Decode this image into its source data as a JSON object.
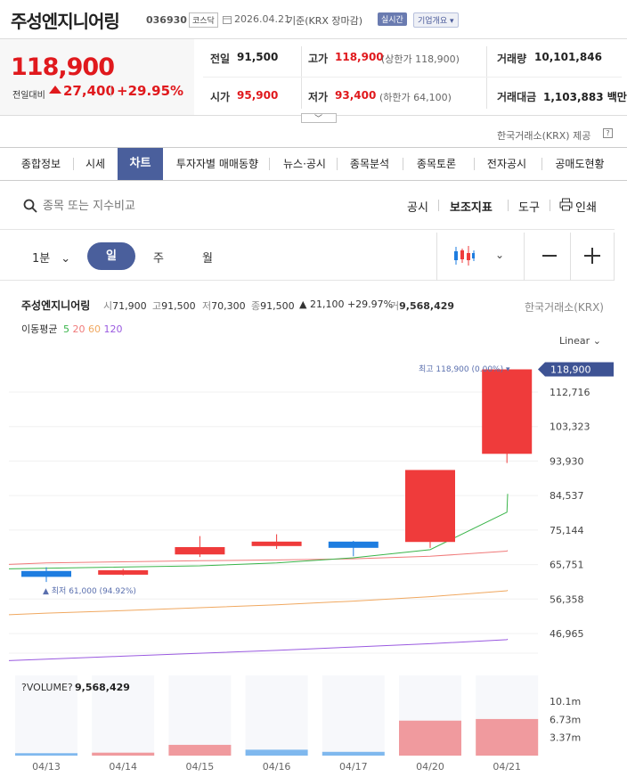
{
  "header": {
    "name": "주성엔지니어링",
    "code": "036930",
    "market_badge": "코스닥",
    "date": "2026.04.21",
    "basis": "기준(KRX 장마감)",
    "live_badge": "실시간",
    "company_badge": "기업개요"
  },
  "price": {
    "current": "118,900",
    "change_label": "전일대비",
    "change": "27,400",
    "change_pct": "+29.95%"
  },
  "stats": {
    "prev_label": "전일",
    "prev": "91,500",
    "high_label": "고가",
    "high": "118,900",
    "high_sub": "(상한가 118,900)",
    "volume_label": "거래량",
    "volume": "10,101,846",
    "open_label": "시가",
    "open": "95,900",
    "low_label": "저가",
    "low": "93,400",
    "low_sub": "(하한가 64,100)",
    "amount_label": "거래대금",
    "amount": "1,103,883 백만"
  },
  "provider": "한국거래소(KRX) 제공",
  "tabs": [
    {
      "label": "종합정보"
    },
    {
      "label": "시세"
    },
    {
      "label": "차트"
    },
    {
      "label": "투자자별 매매동향"
    },
    {
      "label": "뉴스·공시"
    },
    {
      "label": "종목분석"
    },
    {
      "label": "종목토론"
    },
    {
      "label": "전자공시"
    },
    {
      "label": "공매도현황"
    }
  ],
  "toolbar": {
    "search_placeholder": "종목 또는 지수비교",
    "disclosure": "공시",
    "indicator": "보조지표",
    "tools": "도구",
    "print": "인쇄"
  },
  "periods": {
    "minute": "1분",
    "day": "일",
    "week": "주",
    "month": "월"
  },
  "info": {
    "name": "주성엔지니어링",
    "open_k": "시",
    "open": "71,900",
    "high_k": "고",
    "high": "91,500",
    "low_k": "저",
    "low": "70,300",
    "close_k": "종",
    "close": "91,500",
    "change": "▲ 21,100 +29.97%",
    "vol_k": "거",
    "vol": "9,568,429",
    "exchange": "한국거래소(KRX)",
    "ma_label": "이동평균",
    "ma5": "5",
    "ma20": "20",
    "ma60": "60",
    "ma120": "120",
    "scale": "Linear"
  },
  "colors": {
    "up": "#ef3b3b",
    "down": "#1e7de0",
    "ma5": "#3ab54a",
    "ma20": "#f07a7a",
    "ma60": "#f0a860",
    "ma120": "#9a5ae0",
    "accent": "#4a5f9c"
  },
  "chart_data": {
    "type": "candlestick",
    "y_axis_ticks": [
      "112,716",
      "103,323",
      "93,930",
      "84,537",
      "75,144",
      "65,751",
      "56,358",
      "46,965"
    ],
    "last_price_tag": "118,900",
    "max_label": "최고 118,900 (0.00%)",
    "min_label": "최저 61,000 (94.92%)",
    "candles": [
      {
        "date": "04/13",
        "open": 64000,
        "high": 65000,
        "low": 61000,
        "close": 62400
      },
      {
        "date": "04/14",
        "open": 63400,
        "high": 64600,
        "low": 62800,
        "close": 64200
      },
      {
        "date": "04/15",
        "open": 68500,
        "high": 73500,
        "low": 67800,
        "close": 70500
      },
      {
        "date": "04/16",
        "open": 71000,
        "high": 74000,
        "low": 70000,
        "close": 72000
      },
      {
        "date": "04/17",
        "open": 72000,
        "high": 72200,
        "low": 68000,
        "close": 70300
      },
      {
        "date": "04/20",
        "open": 71900,
        "high": 91500,
        "low": 70300,
        "close": 91500
      },
      {
        "date": "04/21",
        "open": 95900,
        "high": 118900,
        "low": 93400,
        "close": 118900
      }
    ],
    "ma5": [
      65400,
      66200,
      67600,
      69800,
      80000
    ],
    "ma20": [
      66200,
      66500,
      66800,
      67000,
      67300,
      68000,
      69400
    ],
    "ma60": [
      52500,
      53200,
      54000,
      54800,
      55800,
      57000,
      58600
    ],
    "ma120": [
      40000,
      40800,
      41600,
      42400,
      43300,
      44200,
      45300
    ],
    "volume_label": "?VOLUME?",
    "volume_value": "9,568,429",
    "volume_ticks": [
      "10.1m",
      "6.73m",
      "3.37m"
    ],
    "volumes": [
      0.45,
      0.55,
      2.0,
      1.1,
      0.7,
      6.5,
      6.8
    ],
    "volume_up": [
      false,
      true,
      true,
      false,
      false,
      true,
      true
    ],
    "dates": [
      "04/13",
      "04/14",
      "04/15",
      "04/16",
      "04/17",
      "04/20",
      "04/21"
    ]
  }
}
